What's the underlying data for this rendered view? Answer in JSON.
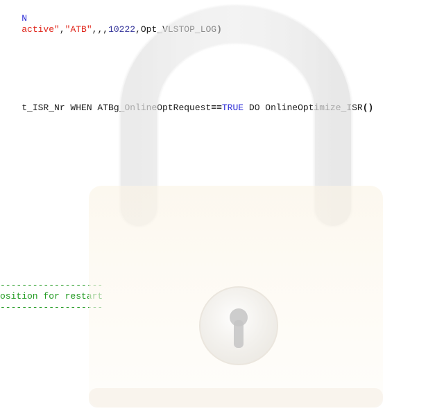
{
  "editor": {
    "line1": {
      "keyword": "N"
    },
    "line2": {
      "s1": "active\"",
      "c1": ",",
      "s2": "\"ATB\"",
      "c2": ",,,",
      "num": "10222",
      "rest": ",Opt_VLSTOP_LOG",
      "paren": ")"
    },
    "line3": {
      "p1": "t_ISR_Nr WHEN ATBg_OnlineOptRequest",
      "op": "==",
      "kw": "TRUE",
      "p2": " DO OnlineOptimize_ISR",
      "paren": "()"
    },
    "comment": {
      "divider_top": "-------------------",
      "text": "osition for restart",
      "divider_bottom": "-------------------"
    }
  },
  "overlay": {
    "icon": "padlock-icon",
    "colors": {
      "shackle": "#e6e6e6",
      "body": "#fdf8ee",
      "keyhole": "#bfbfbf"
    }
  },
  "colors": {
    "keyword": "#2a2ad6",
    "string": "#e0251a",
    "number": "#333399",
    "comment": "#219a21",
    "text": "#1a1a1a"
  }
}
